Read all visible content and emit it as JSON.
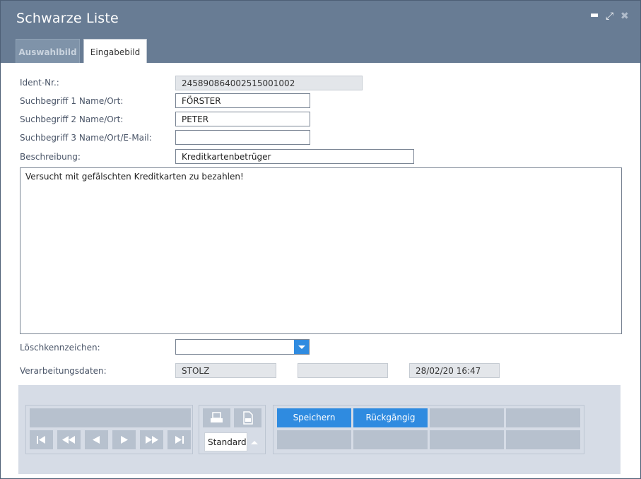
{
  "window": {
    "title": "Schwarze Liste",
    "controls": {
      "minimize": "▬",
      "maximize": "⤢",
      "close": "✖"
    }
  },
  "tabs": [
    {
      "label": "Auswahlbild",
      "active": false
    },
    {
      "label": "Eingabebild",
      "active": true
    }
  ],
  "form": {
    "ident": {
      "label": "Ident-Nr.:",
      "value": "245890864002515001002"
    },
    "such1": {
      "label": "Suchbegriff 1 Name/Ort:",
      "value": "FÖRSTER"
    },
    "such2": {
      "label": "Suchbegriff 2 Name/Ort:",
      "value": "PETER"
    },
    "such3": {
      "label": "Suchbegriff 3 Name/Ort/E-Mail:",
      "value": ""
    },
    "beschreibung": {
      "label": "Beschreibung:",
      "value": "Kreditkartenbetrüger"
    },
    "notes": "Versucht mit gefälschten Kreditkarten zu bezahlen!",
    "loesch": {
      "label": "Löschkennzeichen:",
      "value": ""
    },
    "verarbeitung": {
      "label": "Verarbeitungsdaten:",
      "user": "STOLZ",
      "middle": "",
      "datetime": "28/02/20 16:47"
    }
  },
  "toolbar": {
    "report_select": "Standardli",
    "save_label": "Speichern",
    "undo_label": "Rückgängig"
  },
  "colors": {
    "titlebar": "#687c94",
    "accent": "#2f8be0",
    "panel": "#d6dce6",
    "button_gray": "#b7c1ce"
  }
}
